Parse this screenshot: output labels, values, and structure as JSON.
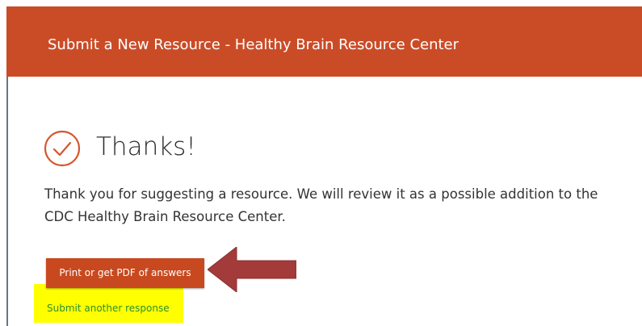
{
  "header": {
    "title": "Submit a New Resource - Healthy Brain Resource Center",
    "background_color": "#ca4c27"
  },
  "confirmation": {
    "icon": "check-circle-icon",
    "title": "Thanks!",
    "message": "Thank you for suggesting a resource. We will review it as a possible addition to the CDC Healthy Brain Resource Center."
  },
  "actions": {
    "print_pdf_label": "Print or get PDF of answers",
    "submit_another_label": "Submit another response"
  },
  "annotations": {
    "arrow_icon": "left-arrow-icon",
    "arrow_color": "#a33b3b",
    "highlight_color": "#ffff00"
  }
}
